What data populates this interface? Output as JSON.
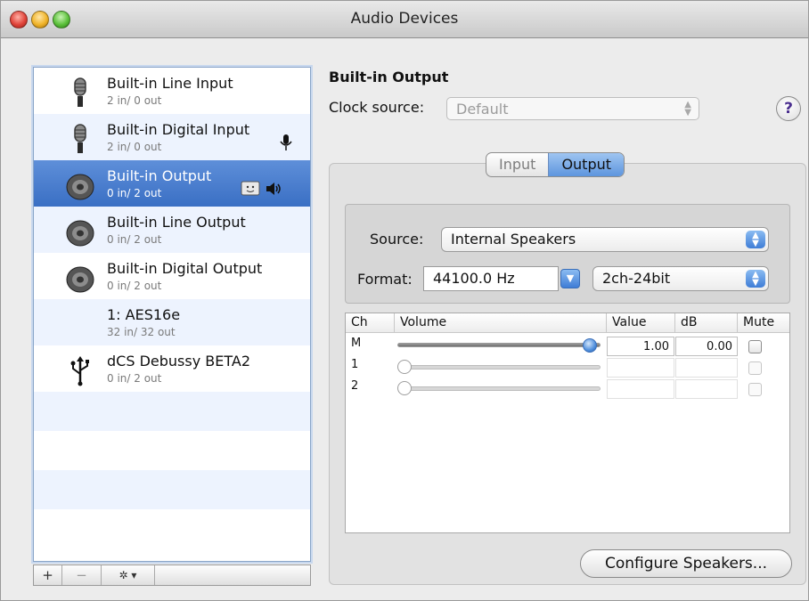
{
  "window": {
    "title": "Audio Devices"
  },
  "devices": [
    {
      "name": "Built-in Line Input",
      "io": "2 in/ 0 out",
      "icon": "microphone-icon"
    },
    {
      "name": "Built-in Digital Input",
      "io": "2 in/ 0 out",
      "icon": "microphone-icon",
      "badge": "default-input-mic-icon"
    },
    {
      "name": "Built-in Output",
      "io": "0 in/ 2 out",
      "icon": "speaker-icon",
      "selected": true,
      "badges": [
        "system-output-finder-icon",
        "default-output-speaker-icon"
      ]
    },
    {
      "name": "Built-in Line Output",
      "io": "0 in/ 2 out",
      "icon": "speaker-icon"
    },
    {
      "name": "Built-in Digital Output",
      "io": "0 in/ 2 out",
      "icon": "speaker-icon"
    },
    {
      "name": "1: AES16e",
      "io": "32 in/ 32 out",
      "icon": ""
    },
    {
      "name": "dCS Debussy BETA2",
      "io": "0 in/ 2 out",
      "icon": "usb-icon"
    }
  ],
  "list_toolbar": {
    "add": "+",
    "remove": "−",
    "action": "✲ ▾"
  },
  "detail": {
    "device_title": "Built-in Output",
    "clock_label": "Clock source:",
    "clock_value": "Default",
    "help": "?",
    "tabs": [
      {
        "label": "Input"
      },
      {
        "label": "Output",
        "active": true
      }
    ],
    "source_label": "Source:",
    "source_value": "Internal Speakers",
    "format_label": "Format:",
    "format_rate": "44100.0 Hz",
    "format_bits": "2ch-24bit",
    "columns": {
      "ch": "Ch",
      "volume": "Volume",
      "value": "Value",
      "db": "dB",
      "mute": "Mute"
    },
    "channels": [
      {
        "ch": "M",
        "level": 1.0,
        "value": "1.00",
        "db": "0.00",
        "enabled": true
      },
      {
        "ch": "1",
        "level": 0.0,
        "value": "",
        "db": "",
        "enabled": false
      },
      {
        "ch": "2",
        "level": 0.0,
        "value": "",
        "db": "",
        "enabled": false
      }
    ],
    "configure_button": "Configure Speakers..."
  },
  "colors": {
    "selection": "#3a6fc4",
    "alt_row": "#edf3fe",
    "accent": "#4f8fdd"
  }
}
